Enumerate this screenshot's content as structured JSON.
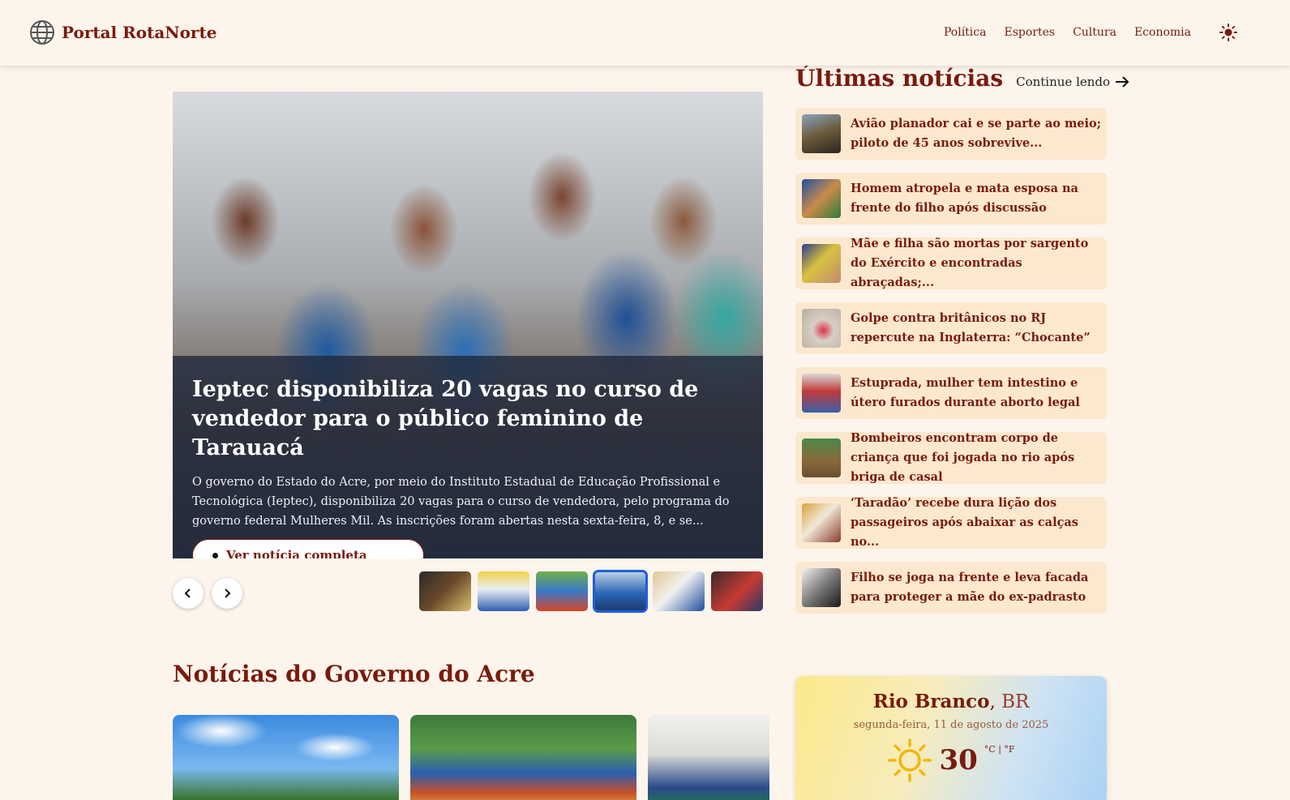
{
  "header": {
    "brand": "Portal RotaNorte",
    "nav": [
      "Política",
      "Esportes",
      "Cultura",
      "Economia"
    ]
  },
  "hero": {
    "title": "Ieptec disponibiliza 20 vagas no curso de vendedor para o público feminino de Tarauacá",
    "excerpt": "O governo do Estado do Acre, por meio do Instituto Estadual de Educação Profissional e Tecnológica (Ieptec), disponibiliza 20 vagas para o curso de vendedora, pelo programa do governo federal Mulheres Mil. As inscrições foram abertas nesta sexta-feira, 8, e se...",
    "button_label": "Ver notícia completa",
    "active_thumbnail": 4
  },
  "latest": {
    "title": "Últimas notícias",
    "continue_label": "Continue lendo",
    "items": [
      "Avião planador cai e se parte ao meio; piloto de 45 anos sobrevive...",
      "Homem atropela e mata esposa na frente do filho após discussão",
      "Mãe e filha são mortas por sargento do Exército e encontradas abraçadas;...",
      "Golpe contra britânicos no RJ repercute na Inglaterra: “Chocante”",
      "Estuprada, mulher tem intestino e útero furados durante aborto legal",
      "Bombeiros encontram corpo de criança que foi jogada no rio após briga de casal",
      "‘Taradão’ recebe dura lição dos passageiros após abaixar as calças no...",
      "Filho se joga na frente e leva facada para proteger a mãe do ex-padrasto"
    ]
  },
  "gov": {
    "title": "Notícias do Governo do Acre"
  },
  "weather": {
    "city": "Rio Branco",
    "country": "BR",
    "date": "segunda-feira, 11 de agosto de 2025",
    "temperature": "30",
    "units": "°C | °F"
  },
  "colors": {
    "background": "#fdf5ec",
    "brand": "#7a1a0c",
    "card": "#fce8cf",
    "active_outline": "#1f5fd6"
  }
}
